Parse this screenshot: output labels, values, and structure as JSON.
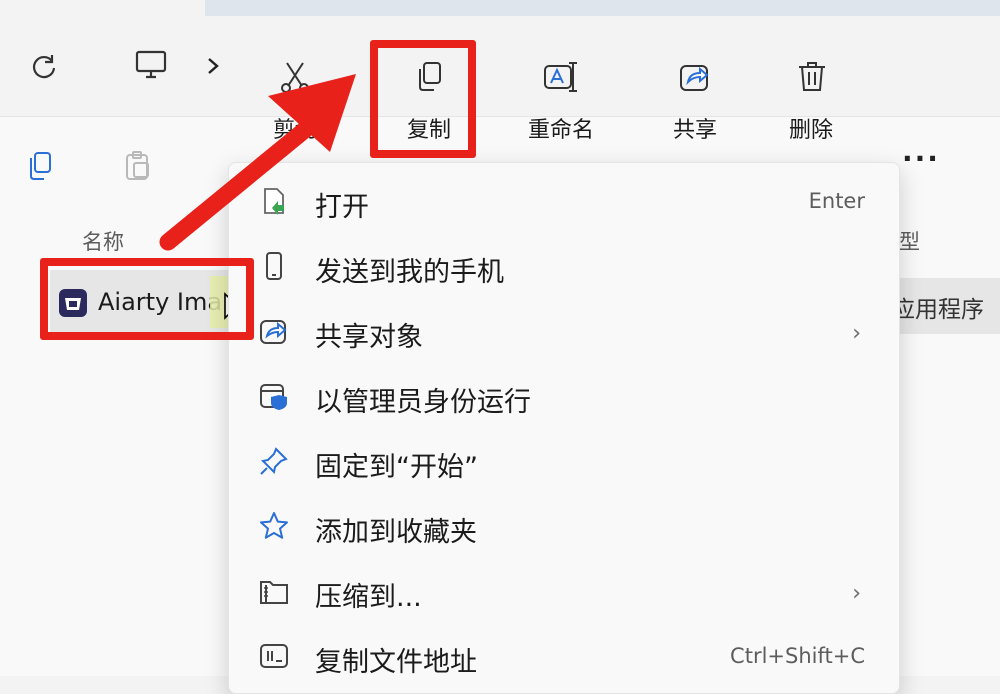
{
  "toolbar": {
    "cut_label": "剪切",
    "copy_label": "复制",
    "rename_label": "重命名",
    "share_label": "共享",
    "delete_label": "删除",
    "more_label": "···"
  },
  "columns": {
    "name": "名称",
    "type": "类型"
  },
  "file": {
    "name": "Aiarty Ima",
    "type": "应用程序"
  },
  "context_menu": {
    "items": [
      {
        "label": "打开",
        "shortcut": "Enter",
        "icon": "open-file-icon"
      },
      {
        "label": "发送到我的手机",
        "shortcut": "",
        "icon": "phone-icon"
      },
      {
        "label": "共享对象",
        "shortcut": "",
        "icon": "share-icon",
        "submenu": "›"
      },
      {
        "label": "以管理员身份运行",
        "shortcut": "",
        "icon": "shield-icon"
      },
      {
        "label": "固定到“开始”",
        "shortcut": "",
        "icon": "pin-icon"
      },
      {
        "label": "添加到收藏夹",
        "shortcut": "",
        "icon": "star-icon"
      },
      {
        "label": "压缩到...",
        "shortcut": "",
        "icon": "zip-folder-icon",
        "submenu": "›"
      },
      {
        "label": "复制文件地址",
        "shortcut": "Ctrl+Shift+C",
        "icon": "copy-path-icon"
      }
    ]
  },
  "colors": {
    "annotation_red": "#e8211b",
    "accent_blue": "#2a6fd6"
  }
}
